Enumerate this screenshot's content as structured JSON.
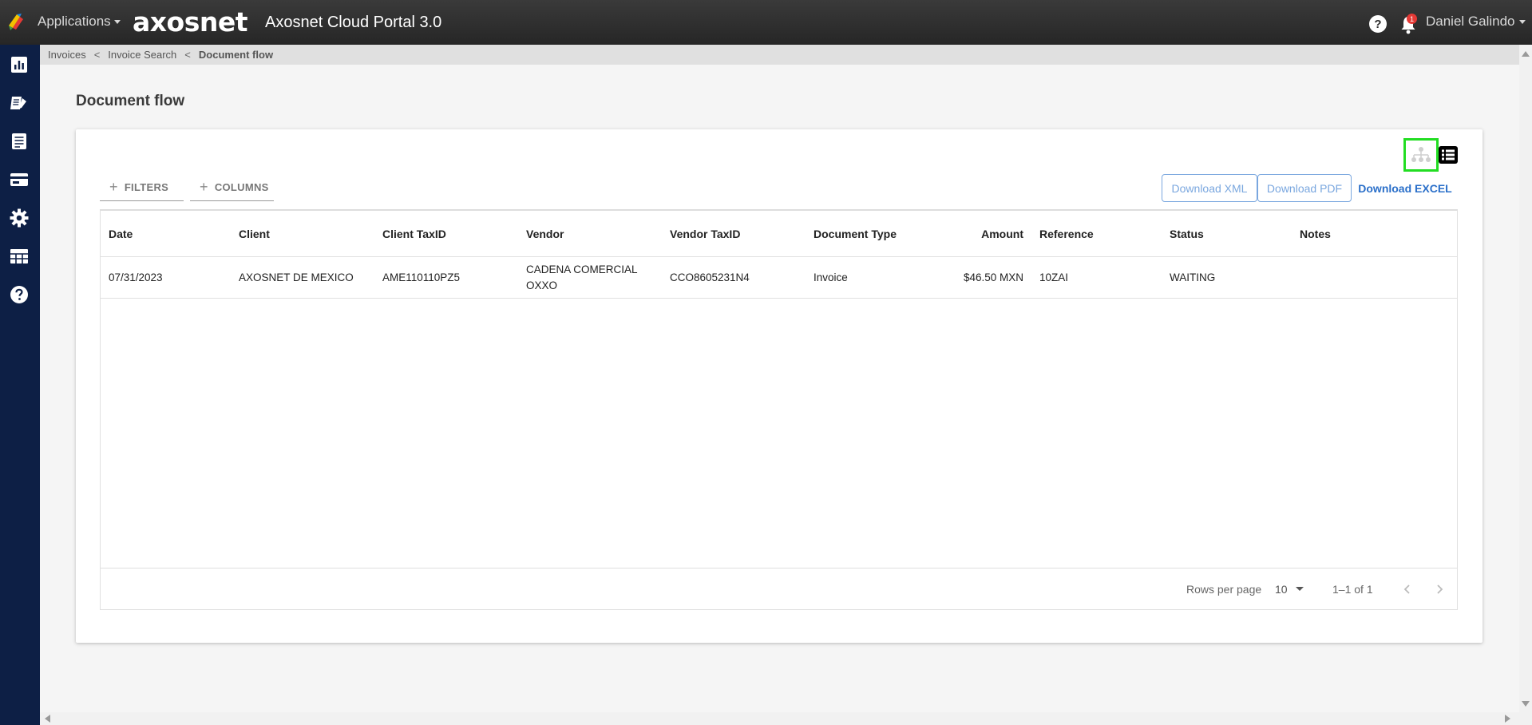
{
  "header": {
    "apps_label": "Applications",
    "brand": "axosnet",
    "portal_title": "Axosnet Cloud Portal 3.0",
    "help_label": "?",
    "notification_count": "1",
    "user_name": "Daniel Galindo"
  },
  "sidebar": {
    "items": [
      {
        "icon": "dashboard-chart-icon"
      },
      {
        "icon": "edit-document-icon"
      },
      {
        "icon": "document-list-icon"
      },
      {
        "icon": "credit-card-icon"
      },
      {
        "icon": "gear-icon"
      },
      {
        "icon": "table-icon"
      },
      {
        "icon": "help-circle-icon"
      }
    ]
  },
  "breadcrumb": {
    "items": [
      "Invoices",
      "Invoice Search"
    ],
    "separator": "<",
    "current": "Document flow"
  },
  "page": {
    "title": "Document flow"
  },
  "toolbar": {
    "filters_label": "FILTERS",
    "columns_label": "COLUMNS",
    "download_xml": "Download XML",
    "download_pdf": "Download PDF",
    "download_excel": "Download EXCEL",
    "view_tree_icon": "hierarchy-icon",
    "view_list_icon": "list-icon"
  },
  "table": {
    "columns": [
      "Date",
      "Client",
      "Client TaxID",
      "Vendor",
      "Vendor TaxID",
      "Document Type",
      "Amount",
      "Reference",
      "Status",
      "Notes"
    ],
    "rows": [
      {
        "date": "07/31/2023",
        "client": "AXOSNET DE MEXICO",
        "client_taxid": "AME110110PZ5",
        "vendor": "CADENA COMERCIAL OXXO",
        "vendor_taxid": "CCO8605231N4",
        "document_type": "Invoice",
        "amount": "$46.50 MXN",
        "reference": "10ZAI",
        "status": "WAITING",
        "notes": ""
      }
    ]
  },
  "pagination": {
    "rows_per_page_label": "Rows per page",
    "rows_per_page_value": "10",
    "range_label": "1–1 of 1"
  },
  "colors": {
    "topbar": "#2e2e2e",
    "sidebar": "#0d1f45",
    "accent": "#2a6fc9",
    "highlight": "#22dd22"
  }
}
